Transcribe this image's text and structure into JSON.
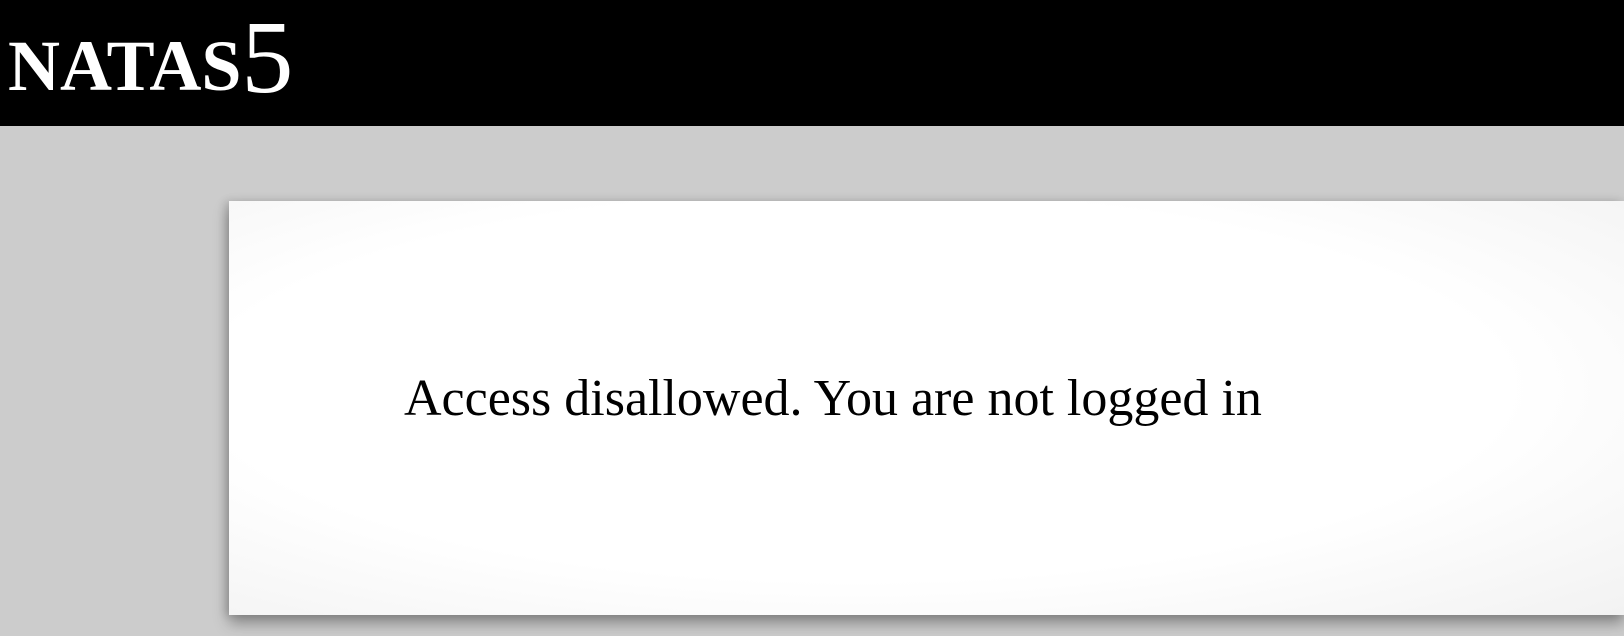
{
  "header": {
    "title_text": "NATAS",
    "title_number": "5"
  },
  "content": {
    "message": "Access disallowed. You are not logged in"
  },
  "colors": {
    "header_background": "#000000",
    "page_background": "#cccccc",
    "content_background": "#ffffff"
  }
}
